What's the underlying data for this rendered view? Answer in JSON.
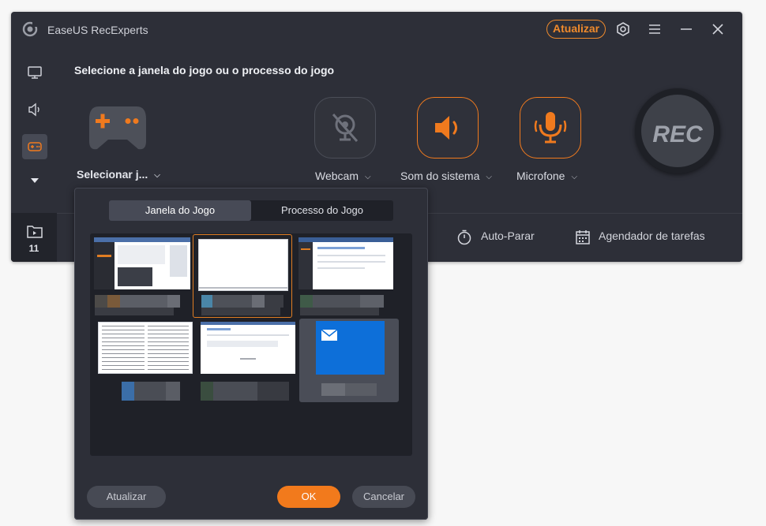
{
  "app": {
    "title": "EaseUS RecExperts",
    "upgrade_label": "Atualizar",
    "accent": "#f07a1e"
  },
  "sidebar": {
    "items": [
      {
        "icon": "monitor-icon"
      },
      {
        "icon": "audio-icon"
      },
      {
        "icon": "gamepad-icon",
        "active": true
      },
      {
        "icon": "chevron-down-icon"
      }
    ],
    "recordings_count": "11"
  },
  "main": {
    "heading": "Selecione a janela do jogo ou o processo do jogo",
    "game_select_label": "Selecionar j...",
    "webcam_label": "Webcam",
    "system_sound_label": "Som do sistema",
    "microphone_label": "Microfone",
    "rec_label": "REC",
    "auto_stop_label": "Auto-Parar",
    "scheduler_label": "Agendador de tarefas"
  },
  "popup": {
    "tabs": [
      {
        "label": "Janela do Jogo",
        "active": true
      },
      {
        "label": "Processo do Jogo",
        "active": false
      }
    ],
    "buttons": {
      "refresh": "Atualizar",
      "ok": "OK",
      "cancel": "Cancelar"
    }
  }
}
